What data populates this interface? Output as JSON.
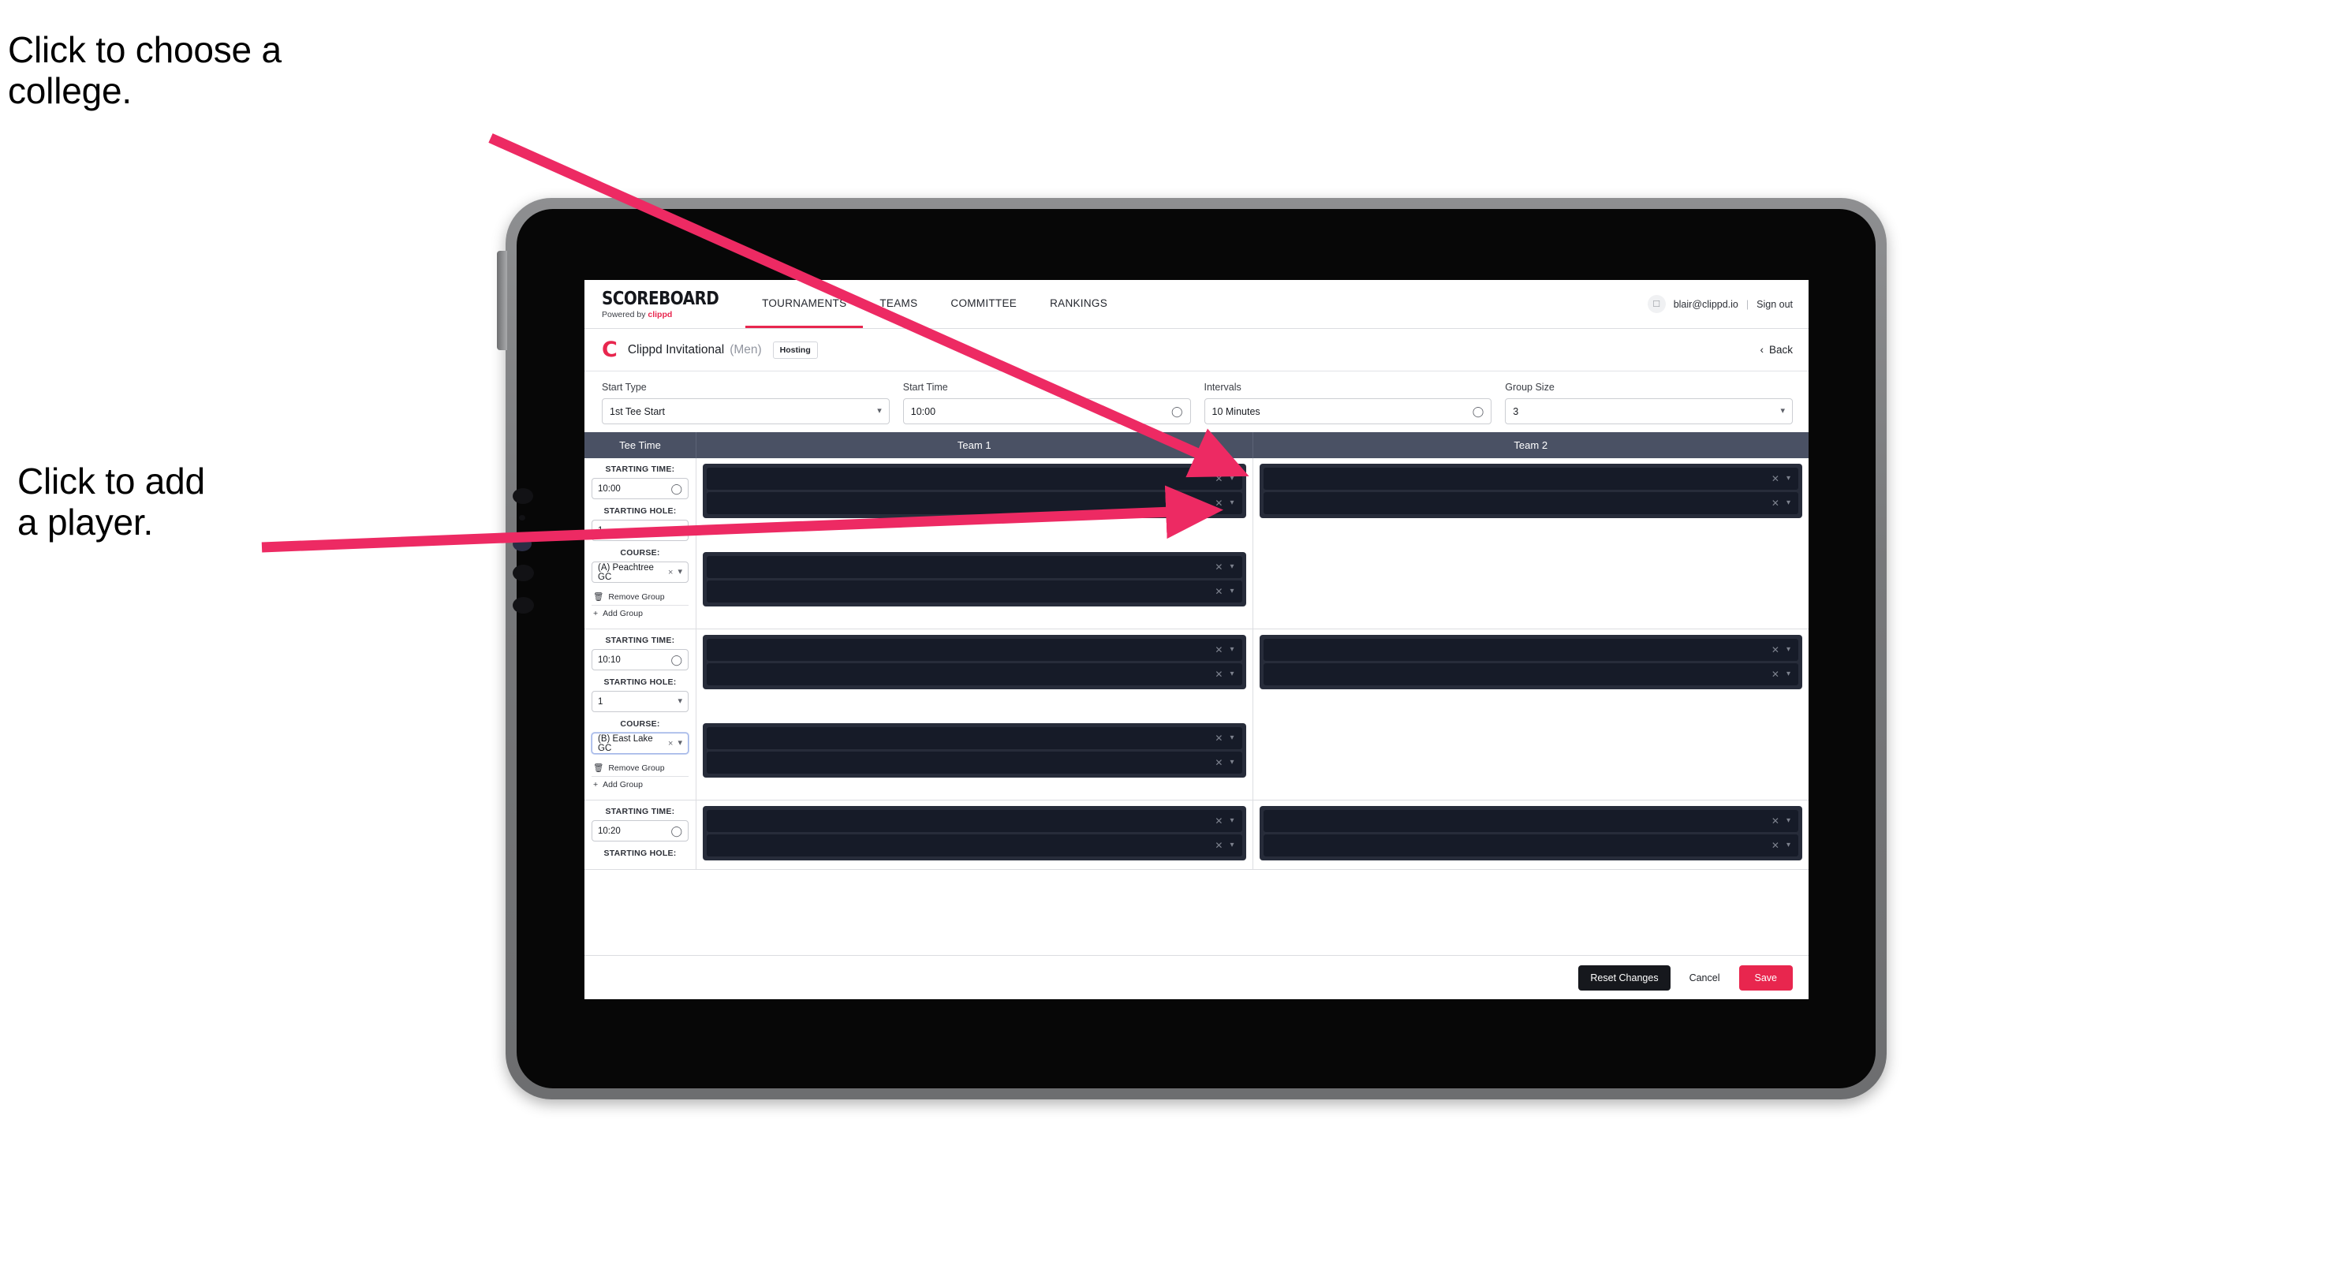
{
  "annotations": {
    "college": "Click to choose a\ncollege.",
    "player": "Click to add\na player."
  },
  "colors": {
    "accent": "#E8264E",
    "arrow": "#ED2A63",
    "table_header": "#4A5164",
    "player_row": "#161B28",
    "group_box": "#272C3A"
  },
  "navbar": {
    "logo_main": "SCOREBOARD",
    "logo_sub_prefix": "Powered by ",
    "logo_brand": "clippd",
    "links": [
      {
        "label": "TOURNAMENTS",
        "active": true
      },
      {
        "label": "TEAMS",
        "active": false
      },
      {
        "label": "COMMITTEE",
        "active": false
      },
      {
        "label": "RANKINGS",
        "active": false
      }
    ],
    "avatar_icon": "user-icon",
    "user_email": "blair@clippd.io",
    "separator": "|",
    "sign_out": "Sign out"
  },
  "title_row": {
    "logo_letter": "C",
    "tournament_name": "Clippd Invitational",
    "gender": "(Men)",
    "badge": "Hosting",
    "back_chevron": "‹",
    "back_label": "Back"
  },
  "controls": [
    {
      "label": "Start Type",
      "value": "1st Tee Start",
      "icon": "stepper-icon"
    },
    {
      "label": "Start Time",
      "value": "10:00",
      "icon": "clock-icon"
    },
    {
      "label": "Intervals",
      "value": "10 Minutes",
      "icon": "clock-icon"
    },
    {
      "label": "Group Size",
      "value": "3",
      "icon": "stepper-icon"
    }
  ],
  "table": {
    "headers": [
      "Tee Time",
      "Team 1",
      "Team 2"
    ],
    "labels": {
      "starting_time": "STARTING TIME:",
      "starting_hole": "STARTING HOLE:",
      "course": "COURSE:",
      "remove_group": "Remove Group",
      "add_group": "Add Group",
      "clear_icon": "×"
    },
    "rows": [
      {
        "starting_time": "10:00",
        "starting_hole": "1",
        "course": "(A) Peachtree GC",
        "course_focused": false,
        "team1_groups": [
          {
            "players": [
              "",
              ""
            ]
          },
          {
            "players": [
              "",
              ""
            ]
          }
        ],
        "team2_groups": [
          {
            "players": [
              "",
              ""
            ]
          }
        ]
      },
      {
        "starting_time": "10:10",
        "starting_hole": "1",
        "course": "(B) East Lake GC",
        "course_focused": true,
        "team1_groups": [
          {
            "players": [
              "",
              ""
            ]
          },
          {
            "players": [
              "",
              ""
            ]
          }
        ],
        "team2_groups": [
          {
            "players": [
              "",
              ""
            ]
          }
        ]
      },
      {
        "starting_time": "10:20",
        "starting_hole": "",
        "course": "",
        "course_focused": false,
        "partial": true,
        "team1_groups": [
          {
            "players": [
              "",
              ""
            ]
          }
        ],
        "team2_groups": [
          {
            "players": [
              "",
              ""
            ]
          }
        ]
      }
    ]
  },
  "footer": {
    "reset": "Reset Changes",
    "cancel": "Cancel",
    "save": "Save"
  }
}
